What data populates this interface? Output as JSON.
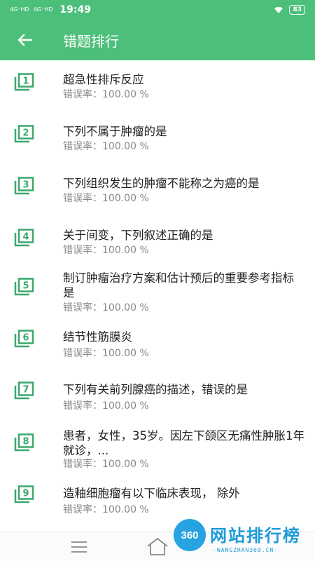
{
  "status_bar": {
    "signal1": "4G⁺HD",
    "signal2": "4G⁺HD",
    "time": "19:49",
    "battery": "83"
  },
  "app_bar": {
    "title": "错题排行"
  },
  "items": [
    {
      "index": "1",
      "question": "超急性排斥反应",
      "rate": "错误率：100.00 %"
    },
    {
      "index": "2",
      "question": "下列不属于肿瘤的是",
      "rate": "错误率：100.00 %"
    },
    {
      "index": "3",
      "question": "下列组织发生的肿瘤不能称之为癌的是",
      "rate": "错误率：100.00 %"
    },
    {
      "index": "4",
      "question": "关于间变，下列叙述正确的是",
      "rate": "错误率：100.00 %"
    },
    {
      "index": "5",
      "question": "制订肿瘤治疗方案和估计预后的重要参考指标是",
      "rate": "错误率：100.00 %"
    },
    {
      "index": "6",
      "question": "结节性筋膜炎",
      "rate": "错误率：100.00 %"
    },
    {
      "index": "7",
      "question": "下列有关前列腺癌的描述，错误的是",
      "rate": "错误率：100.00 %"
    },
    {
      "index": "8",
      "question": "患者，女性，35岁。因左下颌区无痛性肿胀1年就诊，...",
      "rate": "错误率：100.00 %"
    },
    {
      "index": "9",
      "question": "造釉细胞瘤有以下临床表现， 除外",
      "rate": "错误率：100.00 %"
    }
  ],
  "watermark": {
    "logo": "360",
    "text": "网站排行榜",
    "sub": "-WANGZHAN360.CN-"
  },
  "colors": {
    "primary": "#4cbf7a",
    "icon": "#3aa86a"
  }
}
